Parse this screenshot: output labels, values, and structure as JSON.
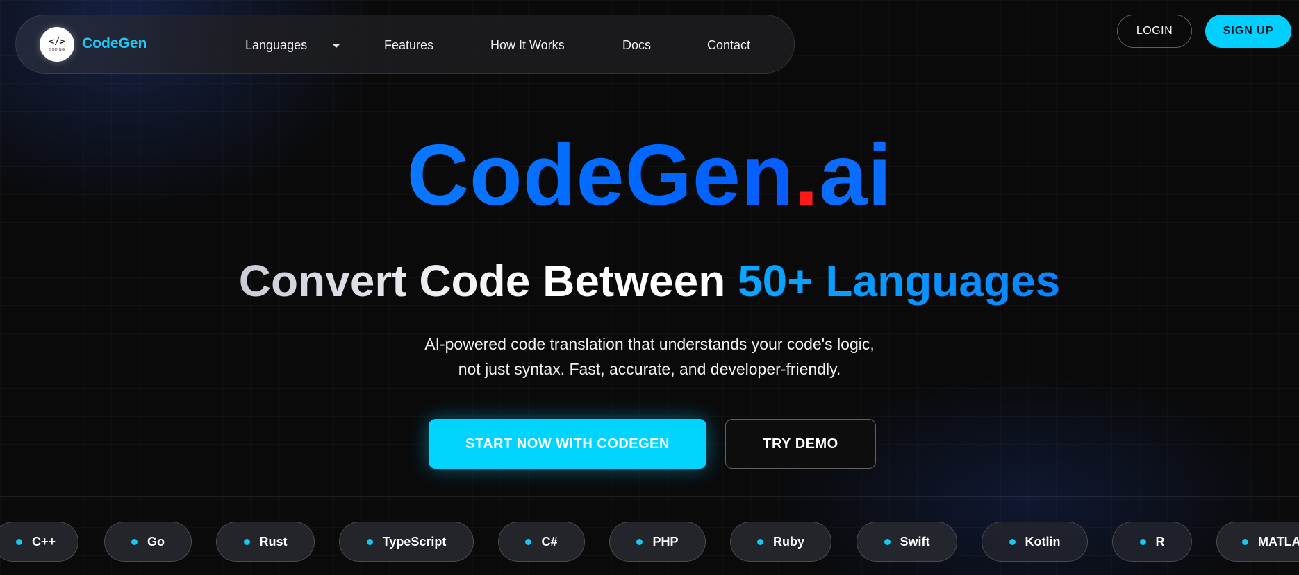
{
  "brand": {
    "logo_text": "</>",
    "logo_subtext": "CODING",
    "name": "CodeGen"
  },
  "nav": {
    "languages": "Languages",
    "features": "Features",
    "how_it_works": "How It Works",
    "docs": "Docs",
    "contact": "Contact"
  },
  "auth": {
    "login": "LOGIN",
    "signup": "SIGN UP"
  },
  "hero": {
    "title_main": "CodeGen",
    "title_dot": ".",
    "title_suffix": "ai",
    "subtitle_white": "Convert Code Between ",
    "subtitle_blue": "50+ Languages",
    "desc_line1": "AI-powered code translation that understands your code's logic,",
    "desc_line2": "not just syntax. Fast, accurate, and developer-friendly.",
    "cta_primary": "START NOW WITH CODEGEN",
    "cta_secondary": "TRY DEMO"
  },
  "languages": [
    "C++",
    "Go",
    "Rust",
    "TypeScript",
    "C#",
    "PHP",
    "Ruby",
    "Swift",
    "Kotlin",
    "R",
    "MATLAB"
  ],
  "colors": {
    "accent_cyan": "#00d4ff",
    "brand_blue": "#0a6dff",
    "dot_red": "#ff1a1a"
  }
}
